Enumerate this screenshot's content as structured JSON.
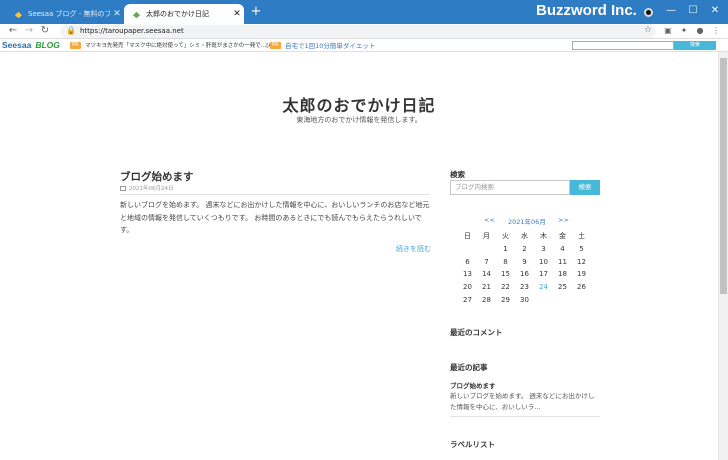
{
  "browser": {
    "tabs": [
      {
        "title": "Seesaa ブログ - 無料のブログ(blog)",
        "active": false
      },
      {
        "title": "太郎のおでかけ日記",
        "active": true
      }
    ],
    "new_tab": "+",
    "brand": "Buzzword Inc.",
    "url": "https://taroupaper.seesaa.net",
    "window_controls": {
      "minimize": "—",
      "maximize": "☐",
      "close": "✕"
    }
  },
  "seesaa_bar": {
    "logo_main": "Seesaa",
    "logo_sub": "BLOG",
    "pr1_badge": "PR",
    "pr1_text": "マツキヨ先発売「マスク中に絶対使って」シミ・肝斑がまさかの一発で…[AD]",
    "pr2_badge": "PR",
    "pr2_text": "自宅で1回10分簡単ダイエット",
    "search_button": "検索"
  },
  "blog": {
    "title": "太郎のおでかけ日記",
    "subtitle": "東海地方のおでかけ情報を発信します。"
  },
  "post": {
    "title": "ブログ始めます",
    "date": "2021年06月24日",
    "body": "新しいブログを始めます。 週末などにお出かけした情報を中心に、おいしいランチのお店など地元と地域の情報を発信していくつもりです。 お時間のあるときにでも読んでもらえたらうれしいです。",
    "read_more": "続きを読む"
  },
  "sidebar": {
    "search_heading": "検索",
    "search_placeholder": "ブログ内検索",
    "search_button": "検索",
    "calendar": {
      "prev": "<<",
      "month": "2021年06月",
      "next": ">>",
      "weekdays": [
        "日",
        "月",
        "火",
        "水",
        "木",
        "金",
        "土"
      ],
      "weeks": [
        [
          "",
          "",
          "1",
          "2",
          "3",
          "4",
          "5"
        ],
        [
          "6",
          "7",
          "8",
          "9",
          "10",
          "11",
          "12"
        ],
        [
          "13",
          "14",
          "15",
          "16",
          "17",
          "18",
          "19"
        ],
        [
          "20",
          "21",
          "22",
          "23",
          "24",
          "25",
          "26"
        ],
        [
          "27",
          "28",
          "29",
          "30",
          "",
          "",
          ""
        ]
      ],
      "highlight": "24"
    },
    "recent_comments_heading": "最近のコメント",
    "recent_posts_heading": "最近の記事",
    "recent_post_title": "ブログ始めます",
    "recent_post_excerpt": "新しいブログを始めます。 週末などにお出かけした情報を中心に、おいしいラ...",
    "label_list_heading": "ラベルリスト"
  },
  "colors": {
    "titlebar": "#2d7cc4",
    "accent": "#48b8d8",
    "link": "#3ea7d2",
    "pr_badge": "#f3a93c"
  }
}
